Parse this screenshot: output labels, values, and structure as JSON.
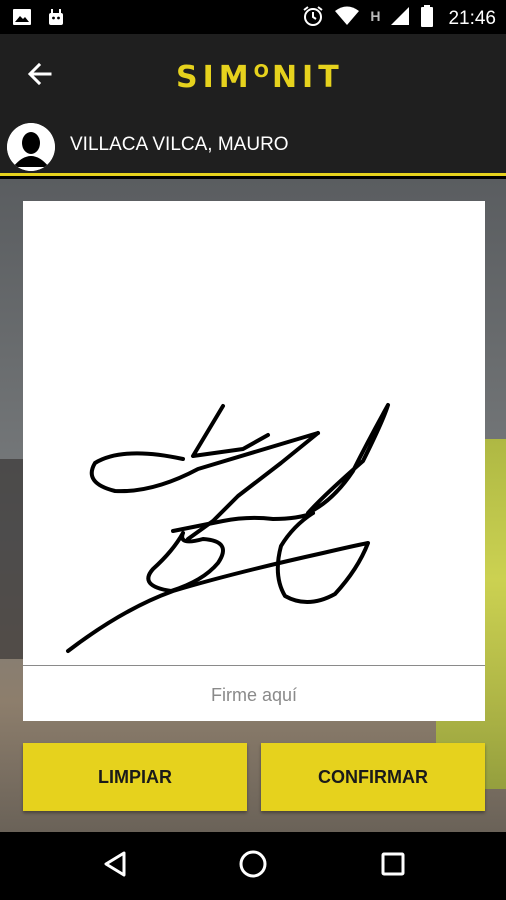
{
  "status_bar": {
    "time": "21:46",
    "indicator_h": "H",
    "icons": [
      "image-icon",
      "android-icon",
      "alarm-icon",
      "wifi-icon",
      "signal-icon",
      "battery-icon"
    ]
  },
  "header": {
    "logo_text_left": "SIM",
    "logo_text_raised": "O",
    "logo_text_right": "NIT",
    "back_icon": "arrow-left-icon"
  },
  "user": {
    "name": "VILLACA VILCA, MAURO",
    "avatar_icon": "user-silhouette-icon"
  },
  "signature": {
    "hint": "Firme aquí"
  },
  "actions": {
    "clear_label": "LIMPIAR",
    "confirm_label": "CONFIRMAR"
  },
  "nav": {
    "icons": [
      "back-triangle-icon",
      "home-circle-icon",
      "recents-square-icon"
    ]
  },
  "colors": {
    "accent": "#e6d21d",
    "header_bg": "#1f1f1f"
  }
}
